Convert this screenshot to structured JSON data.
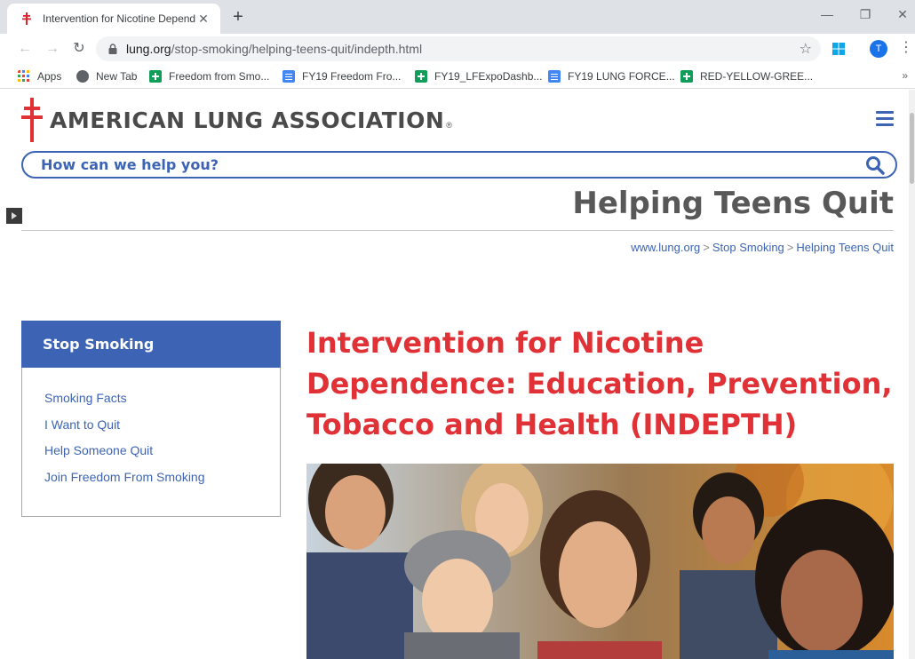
{
  "browser": {
    "tab_title": "Intervention for Nicotine Depend",
    "new_tab_symbol": "+",
    "url_host": "lung.org",
    "url_path": "/stop-smoking/helping-teens-quit/indepth.html",
    "profile_initial": "T",
    "bookmarks": [
      {
        "label": "Apps",
        "icon": "apps-icon"
      },
      {
        "label": "New Tab",
        "icon": "globe-icon"
      },
      {
        "label": "Freedom from Smo...",
        "icon": "sheets-icon"
      },
      {
        "label": "FY19 Freedom Fro...",
        "icon": "docs-icon"
      },
      {
        "label": "FY19_LFExpoDashb...",
        "icon": "sheets-icon"
      },
      {
        "label": "FY19 LUNG FORCE...",
        "icon": "docs-icon"
      },
      {
        "label": "RED-YELLOW-GREE...",
        "icon": "sheets-icon"
      }
    ],
    "bookmarks_overflow": "»"
  },
  "site": {
    "logo_text": "AMERICAN LUNG ASSOCIATION",
    "logo_reg": "®",
    "search_placeholder": "How can we help you?",
    "page_heading": "Helping Teens Quit",
    "breadcrumb": {
      "home": "www.lung.org",
      "section": "Stop Smoking",
      "current": "Helping Teens Quit",
      "separator": ">"
    },
    "sidenav": {
      "title": "Stop Smoking",
      "items": [
        "Smoking Facts",
        "I Want to Quit",
        "Help Someone Quit",
        "Join Freedom From Smoking"
      ]
    },
    "article_title": "Intervention for Nicotine Dependence: Education, Prevention, Tobacco and Health (INDEPTH)",
    "colors": {
      "brand_blue": "#3d64b4",
      "brand_red": "#e03236",
      "heading_gray": "#585858"
    }
  }
}
